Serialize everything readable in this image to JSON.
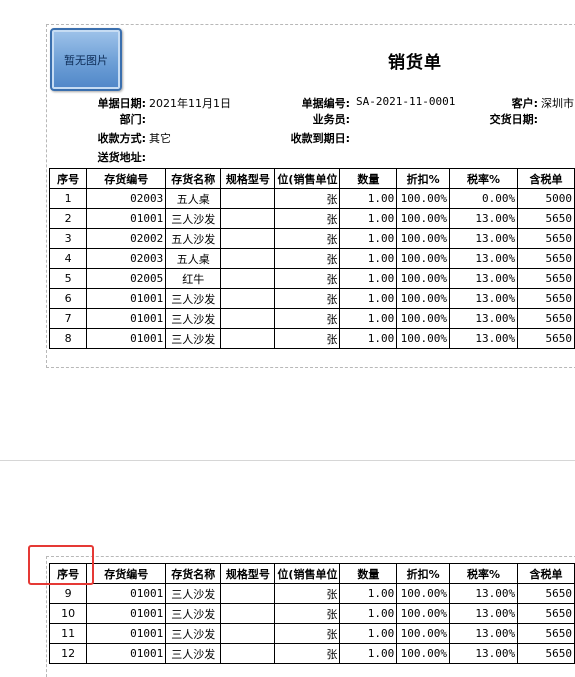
{
  "doc": {
    "title": "销货单",
    "logo_text": "暂无图片"
  },
  "header": {
    "date_label": "单据日期:",
    "date_value": "2021年11月1日",
    "number_label": "单据编号:",
    "number_value": "SA-2021-11-0001",
    "customer_label": "客户:",
    "customer_value": "深圳市",
    "dept_label": "部门:",
    "dept_value": "",
    "salesman_label": "业务员:",
    "salesman_value": "",
    "delivery_date_label": "交货日期:",
    "delivery_date_value": "",
    "payment_label": "收款方式:",
    "payment_value": "其它",
    "due_label": "收款到期日:",
    "due_value": "",
    "address_label": "送货地址:",
    "address_value": ""
  },
  "table": {
    "columns": [
      "序号",
      "存货编号",
      "存货名称",
      "规格型号",
      "位(销售单位",
      "数量",
      "折扣%",
      "税率%",
      "含税单"
    ],
    "rows_page1": [
      [
        "1",
        "02003",
        "五人桌",
        "",
        "张",
        "1.00",
        "100.00%",
        "0.00%",
        "5000"
      ],
      [
        "2",
        "01001",
        "三人沙发",
        "",
        "张",
        "1.00",
        "100.00%",
        "13.00%",
        "5650"
      ],
      [
        "3",
        "02002",
        "五人沙发",
        "",
        "张",
        "1.00",
        "100.00%",
        "13.00%",
        "5650"
      ],
      [
        "4",
        "02003",
        "五人桌",
        "",
        "张",
        "1.00",
        "100.00%",
        "13.00%",
        "5650"
      ],
      [
        "5",
        "02005",
        "红牛",
        "",
        "张",
        "1.00",
        "100.00%",
        "13.00%",
        "5650"
      ],
      [
        "6",
        "01001",
        "三人沙发",
        "",
        "张",
        "1.00",
        "100.00%",
        "13.00%",
        "5650"
      ],
      [
        "7",
        "01001",
        "三人沙发",
        "",
        "张",
        "1.00",
        "100.00%",
        "13.00%",
        "5650"
      ],
      [
        "8",
        "01001",
        "三人沙发",
        "",
        "张",
        "1.00",
        "100.00%",
        "13.00%",
        "5650"
      ]
    ],
    "rows_page2": [
      [
        "9",
        "01001",
        "三人沙发",
        "",
        "张",
        "1.00",
        "100.00%",
        "13.00%",
        "5650"
      ],
      [
        "10",
        "01001",
        "三人沙发",
        "",
        "张",
        "1.00",
        "100.00%",
        "13.00%",
        "5650"
      ],
      [
        "11",
        "01001",
        "三人沙发",
        "",
        "张",
        "1.00",
        "100.00%",
        "13.00%",
        "5650"
      ],
      [
        "12",
        "01001",
        "三人沙发",
        "",
        "张",
        "1.00",
        "100.00%",
        "13.00%",
        "5650"
      ]
    ]
  },
  "colors": {
    "highlight": "#e53935",
    "logo_blue": "#6d9fd6"
  }
}
